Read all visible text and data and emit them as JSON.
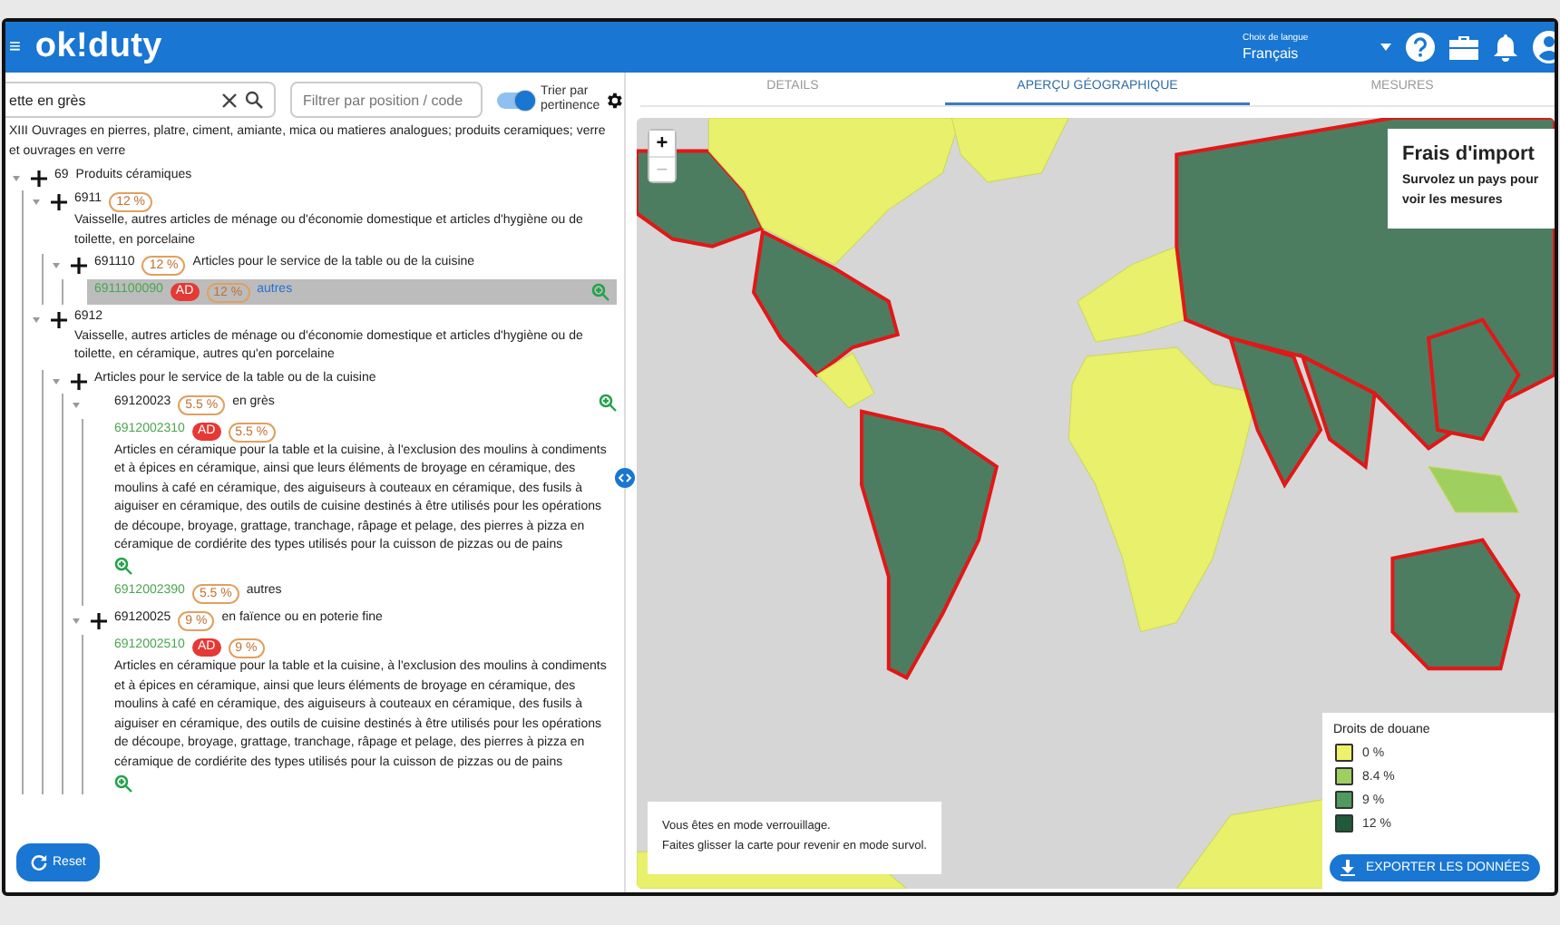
{
  "header": {
    "logo": "ok!duty",
    "menu_glyph": "≡",
    "language_label": "Choix de langue",
    "language_value": "Français"
  },
  "search": {
    "value": "ette en grès"
  },
  "filter": {
    "placeholder": "Filtrer par position / code"
  },
  "sort_toggle": {
    "label": "Trier par pertinence",
    "on": true
  },
  "section": "XIII Ouvrages en pierres, platre, ciment, amiante, mica ou matieres analogues; produits ceramiques; verre et ouvrages en verre",
  "tree": [
    {
      "kind": "heading",
      "code": "69",
      "text": "Produits céramiques",
      "plus": true,
      "expanded": true,
      "children": [
        {
          "kind": "heading",
          "code": "6911",
          "rate": "12 %",
          "text": "Vaisselle, autres articles de ménage ou d'économie domestique et articles d'hygiène ou de toilette, en porcelaine",
          "plus": true,
          "expanded": true,
          "children": [
            {
              "kind": "heading",
              "code": "691110",
              "rate": "12 %",
              "text": "Articles pour le service de la table ou de la cuisine",
              "plus": true,
              "expanded": true,
              "children": [
                {
                  "kind": "leaf",
                  "code": "6911100090",
                  "ad": "AD",
                  "rate": "12 %",
                  "text": "autres",
                  "zoom": true,
                  "selected": true
                }
              ]
            }
          ]
        },
        {
          "kind": "heading",
          "code": "6912",
          "text": "Vaisselle, autres articles de ménage ou d'économie domestique et articles d'hygiène ou de toilette, en céramique, autres qu'en porcelaine",
          "plus": true,
          "expanded": true,
          "children": [
            {
              "kind": "heading",
              "text": "Articles pour le service de la table ou de la cuisine",
              "plus": true,
              "expanded": true,
              "children": [
                {
                  "kind": "heading",
                  "code": "69120023",
                  "rate": "5.5 %",
                  "text": "en grès",
                  "plus": false,
                  "zoom": true,
                  "expanded": true,
                  "children": [
                    {
                      "kind": "leaf",
                      "code": "6912002310",
                      "ad": "AD",
                      "rate": "5.5 %",
                      "text": "Articles en céramique pour la table et la cuisine, à l'exclusion des moulins à condiments et à épices en céramique, ainsi que leurs éléments de broyage en céramique, des moulins à café en céramique, des aiguiseurs à couteaux en céramique, des fusils à aiguiser en céramique, des outils de cuisine destinés à être utilisés pour les opérations de découpe, broyage, grattage, tranchage, râpage et pelage, des pierres à pizza en céramique de cordiérite des types utilisés pour la cuisson de pizzas ou de pains",
                      "zoom": true,
                      "selected": false
                    },
                    {
                      "kind": "leaf",
                      "code": "6912002390",
                      "rate": "5.5 %",
                      "text": "autres",
                      "selected": false
                    }
                  ]
                },
                {
                  "kind": "heading",
                  "code": "69120025",
                  "rate": "9 %",
                  "text": "en faïence ou en poterie fine",
                  "plus": true,
                  "expanded": true,
                  "children": [
                    {
                      "kind": "leaf",
                      "code": "6912002510",
                      "ad": "AD",
                      "rate": "9 %",
                      "text": "Articles en céramique pour la table et la cuisine, à l'exclusion des moulins à condiments et à épices en céramique, ainsi que leurs éléments de broyage en céramique, des moulins à café en céramique, des aiguiseurs à couteaux en céramique, des fusils à aiguiser en céramique, des outils de cuisine destinés à être utilisés pour les opérations de découpe, broyage, grattage, tranchage, râpage et pelage, des pierres à pizza en céramique de cordiérite des types utilisés pour la cuisson de pizzas ou de pains",
                      "zoom": true,
                      "selected": false
                    }
                  ]
                }
              ]
            }
          ]
        }
      ]
    }
  ],
  "reset_button": "Reset",
  "tabs": [
    {
      "label": "DETAILS",
      "selected": false
    },
    {
      "label": "APERÇU GÉOGRAPHIQUE",
      "selected": true
    },
    {
      "label": "MESURES",
      "selected": false
    }
  ],
  "map": {
    "zoom_in": {
      "label": "+",
      "disabled": false
    },
    "zoom_out": {
      "label": "−",
      "disabled": true
    },
    "info": {
      "title": "Frais d'import",
      "text": "Survolez un pays pour voir les mesures"
    },
    "legend": {
      "title": "Droits de douane",
      "items": [
        {
          "label": "0 %",
          "color": "#eef26a"
        },
        {
          "label": "8.4 %",
          "color": "#9fcf5f"
        },
        {
          "label": "9 %",
          "color": "#4f9a5c"
        },
        {
          "label": "12 %",
          "color": "#1f5a3a"
        }
      ]
    },
    "notice": [
      "Vous êtes en mode verrouillage.",
      "Faites glisser la carte pour revenir en mode survol."
    ],
    "export_button": "EXPORTER LES DONNÉES"
  }
}
